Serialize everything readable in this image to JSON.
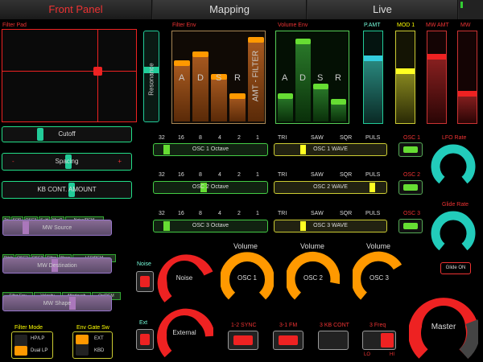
{
  "tabs": [
    {
      "label": "Front Panel",
      "active": true
    },
    {
      "label": "Mapping",
      "active": false
    },
    {
      "label": "Live",
      "active": false
    }
  ],
  "filter_pad": {
    "label": "Filter Pad"
  },
  "resonance": {
    "label": "Resonance"
  },
  "filter_env": {
    "label": "Filter Env",
    "stages": [
      "A",
      "D",
      "S",
      "R"
    ],
    "amt_label": "AMT - FILTER"
  },
  "volume_env": {
    "label": "Volume Env",
    "stages": [
      "A",
      "D",
      "S",
      "R"
    ]
  },
  "sliders": {
    "p_amt": "P.AMT",
    "mod1": "MOD 1",
    "mw_amt": "MW AMT",
    "mw": "MW"
  },
  "cutoff": "Cutoff",
  "spacing": {
    "label": "Spacing",
    "minus": "-",
    "plus": "+"
  },
  "kb_cont": "KB CONT. AMOUNT",
  "oct_values": [
    "32",
    "16",
    "8",
    "4",
    "2",
    "1"
  ],
  "wave_values": [
    "TRI",
    "SAW",
    "SQR",
    "PULS"
  ],
  "osc_rows": [
    {
      "octave": "OSC 1 Octave",
      "wave": "OSC 1 WAVE",
      "btn": "OSC 1"
    },
    {
      "octave": "OSC 2 Octave",
      "wave": "OSC 2 WAVE",
      "btn": "OSC 2"
    },
    {
      "octave": "OSC 3 Octave",
      "wave": "OSC 3 WAVE",
      "btn": "OSC 3"
    }
  ],
  "lfo_rate": "LFO Rate",
  "glide_rate": "Glide Rate",
  "glide_on": "Glide ON",
  "mw_source": {
    "tags": [
      "Tri",
      "SQR",
      "OSC3",
      "S+H",
      "Mod2",
      "Noise/PGM"
    ],
    "label": "MW Source"
  },
  "mw_dest": {
    "tags": [
      "Pitch",
      "OSC2",
      "OSC3",
      "Filter",
      "Wave",
      "LFO/PGM"
    ],
    "label": "MW Destination"
  },
  "mw_shape": {
    "tags": [
      "Filter Env",
      "Velocity",
      "Aftertouch",
      "On/PGM"
    ],
    "label": "MW Shape"
  },
  "noise": {
    "label": "Noise",
    "knob": "Noise"
  },
  "ext": {
    "label": "Ext",
    "knob": "External"
  },
  "osc_knobs": [
    {
      "title": "Volume",
      "label": "OSC 1"
    },
    {
      "title": "Volume",
      "label": "OSC 2"
    },
    {
      "title": "Volume",
      "label": "OSC 3"
    }
  ],
  "sync_buttons": [
    "1-2 SYNC",
    "3-1 FM",
    "3 KB CONT",
    "3 Freq"
  ],
  "freq_lo": "LO",
  "freq_hi": "HI",
  "master": "Master",
  "filter_mode": {
    "label": "Filter Mode",
    "opt1": "HP/LP",
    "opt2": "Dual LP"
  },
  "env_gate": {
    "label": "Env Gate Sw",
    "opt1": "EXT",
    "opt2": "KBD"
  }
}
